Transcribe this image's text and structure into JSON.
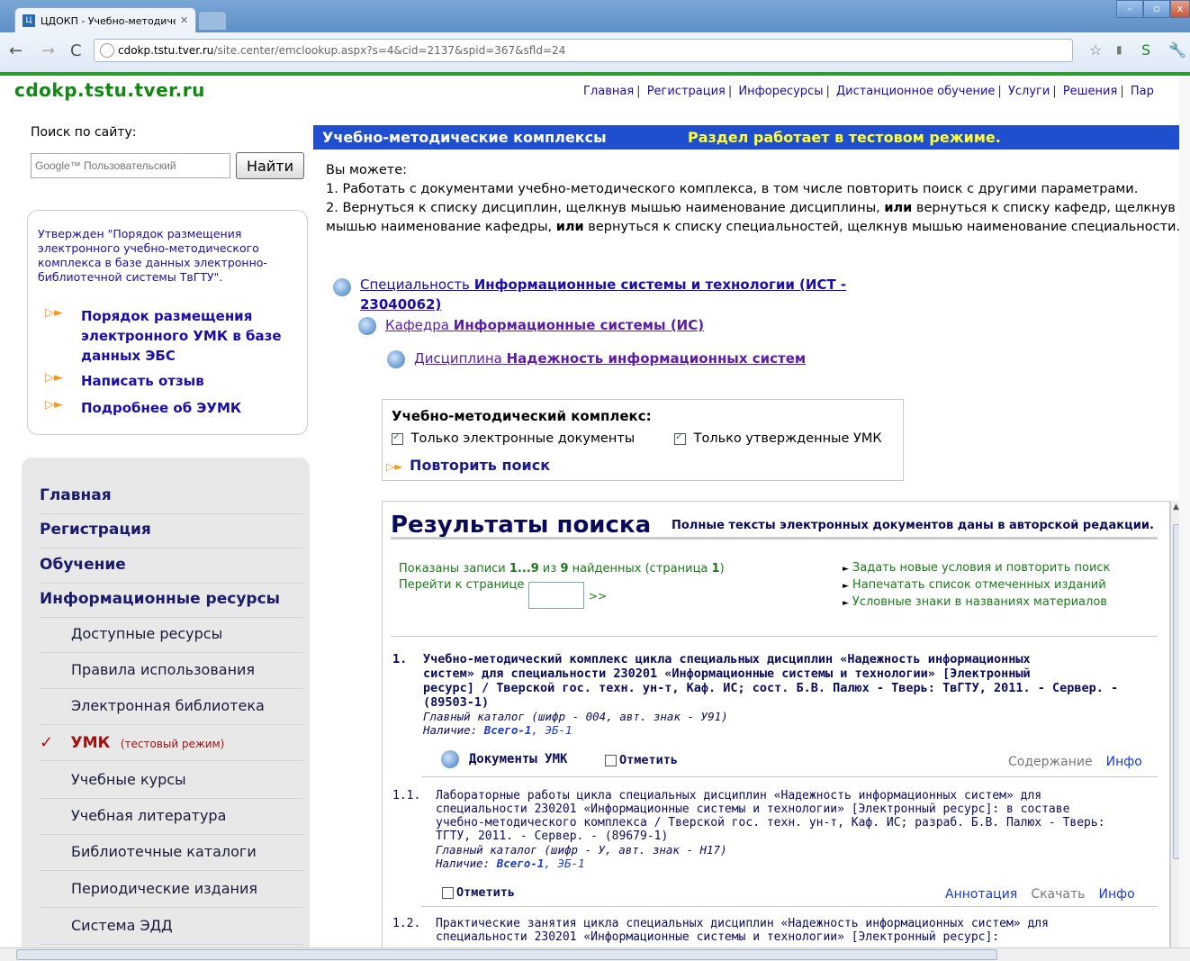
{
  "browser": {
    "tab_title": "ЦДОКП - Учебно-методичес",
    "tab_favicon": "Ц",
    "url_domain": "cdokp.tstu.tver.ru",
    "url_path": "/site.center/emclookup.aspx?s=4&cid=2137&spid=367&sfld=24"
  },
  "site": {
    "logo": "cdokp.tstu.tver.ru",
    "nav": [
      "Главная",
      "Регистрация",
      "Инфоресурсы",
      "Дистанционное обучение",
      "Услуги",
      "Решения",
      "Пар"
    ]
  },
  "search": {
    "label": "Поиск по сайту:",
    "placeholder": "Google™ Пользовательский",
    "button": "Найти"
  },
  "info_box": {
    "text": "Утвержден \"Порядок размещения электронного учебно-методического комплекса в базе данных электронно-библиотечной системы ТвГТУ\".",
    "links": [
      "Порядок размещения электронного УМК в базе данных ЭБС",
      "Написать отзыв",
      "Подробнее об ЭУМК"
    ]
  },
  "menu": {
    "top": [
      "Главная",
      "Регистрация",
      "Обучение",
      "Информационные ресурсы"
    ],
    "sub": [
      "Доступные ресурсы",
      "Правила использования",
      "Электронная библиотека"
    ],
    "active_label": "УМК",
    "active_note": "(тестовый режим)",
    "sub2": [
      "Учебные курсы",
      "Учебная литература",
      "Библиотечные каталоги",
      "Периодические издания",
      "Система ЭДД"
    ]
  },
  "main": {
    "bar_title": "Учебно-методические комплексы",
    "bar_notice": "Раздел работает в тестовом режиме.",
    "intro_lines": [
      "Вы можете:",
      "1. Работать с документами учебно-методического комплекса, в том числе повторить поиск с другими параметрами.",
      "2. Вернуться к списку дисциплин, щелкнув мышью наименование дисциплины, ",
      "или",
      " вернуться к списку кафедр, щелкнув мышью наименование кафедры, ",
      "или",
      " вернуться к списку специальностей, щелкнув мышью наименование специальности."
    ],
    "crumbs": {
      "spec_prefix": "Специальность",
      "spec_name": "Информационные системы и технологии (ИСТ -",
      "spec_name2": "23040062)",
      "dept_prefix": "Кафедра",
      "dept_name": "Информационные системы (ИС)",
      "disc_prefix": "Дисциплина",
      "disc_name": "Надежность информационных систем"
    },
    "umk_box": {
      "title": "Учебно-методический комплекс:",
      "cb1": "Только электронные документы",
      "cb2": "Только утвержденные УМК",
      "repeat": "Повторить поиск"
    }
  },
  "results": {
    "title": "Результаты поиска",
    "note": "Полные тексты электронных документов даны в авторской редакции.",
    "shown_prefix": "Показаны записи ",
    "shown_range": "1...9",
    "shown_mid": " из ",
    "shown_total": "9",
    "shown_suffix": " найденных (страница ",
    "shown_page": "1",
    "shown_end": ")",
    "goto_label": "Перейти к странице",
    "goto_btn": ">>",
    "links": [
      "Задать новые условия и повторить поиск",
      "Напечатать список отмеченных изданий",
      "Условные знаки в названиях материалов"
    ],
    "records": [
      {
        "num": "1.",
        "head": [
          "Учебно-методический комплекс цикла специальных дисциплин «Надежность информационных",
          "систем» для специальности 230201 «Информационные системы и технологии» [Электронный",
          "ресурс] / Тверской гос. техн. ун-т, Каф. ИС; сост. Б.В. Палюх - Тверь: ТвГТУ, 2011. - Сервер. -",
          "(89503-1)"
        ],
        "catalog": "Главный каталог  (шифр - 004, авт. знак - У91)",
        "avail_label": "Наличие: ",
        "avail_all": "Всего-1",
        "avail_eb": ", ЭБ-1",
        "docs": "Документы УМК",
        "mark": "Отметить",
        "a1": "Содержание",
        "a2": "Инфо"
      },
      {
        "num": "1.1.",
        "body": [
          "Лабораторные работы цикла специальных дисциплин «Надежность информационных систем» для",
          "специальности 230201 «Информационные системы и технологии» [Электронный ресурс]: в составе",
          "учебно-методического комплекса / Тверской гос. техн. ун-т, Каф. ИС; разраб. Б.В. Палюх - Тверь:",
          "ТГТУ, 2011. - Сервер. - (89679-1)"
        ],
        "catalog": "Главный каталог  (шифр - У, авт. знак - Н17)",
        "avail_label": "Наличие: ",
        "avail_all": "Всего-1",
        "avail_eb": ", ЭБ-1",
        "mark": "Отметить",
        "a0": "Аннотация",
        "a1": "Скачать",
        "a2": "Инфо"
      },
      {
        "num": "1.2.",
        "body": [
          "Практические занятия цикла специальных дисциплин «Надежность информационных систем» для",
          "специальности 230201 «Информационные системы и технологии» [Электронный ресурс]:"
        ]
      }
    ]
  }
}
